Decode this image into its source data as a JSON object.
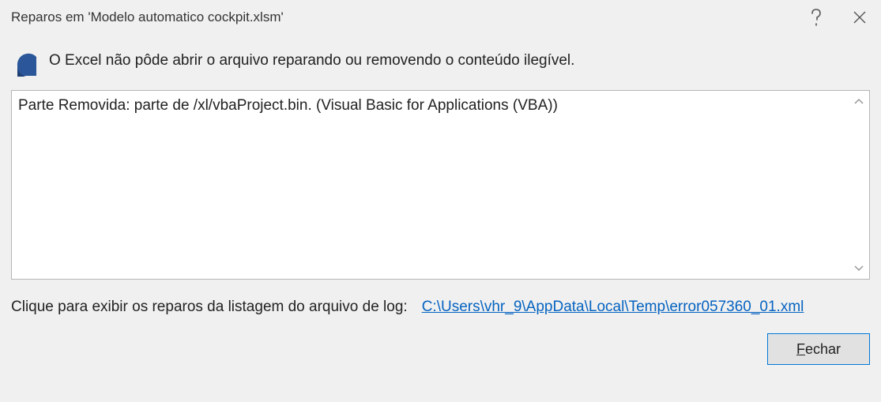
{
  "titlebar": {
    "title": "Reparos em 'Modelo automatico cockpit.xlsm'"
  },
  "message": "O Excel não pôde abrir o arquivo reparando ou removendo o conteúdo ilegível.",
  "details": "Parte Removida: parte de /xl/vbaProject.bin.  (Visual Basic for Applications (VBA))",
  "logrow": {
    "label": "Clique para exibir os reparos da listagem do arquivo de log:",
    "link": "C:\\Users\\vhr_9\\AppData\\Local\\Temp\\error057360_01.xml"
  },
  "footer": {
    "close_prefix": "F",
    "close_rest": "echar"
  }
}
